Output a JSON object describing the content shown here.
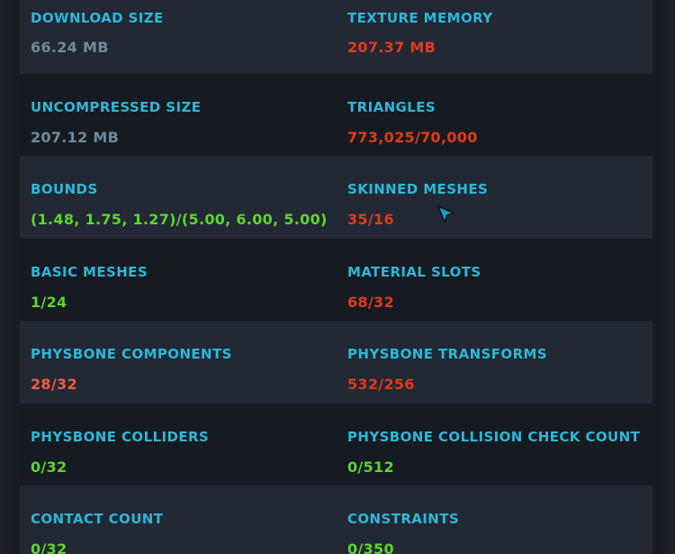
{
  "stats": [
    {
      "left": {
        "label": "DOWNLOAD SIZE",
        "value": "66.24 MB",
        "status": "neutral"
      },
      "right": {
        "label": "TEXTURE MEMORY",
        "value": "207.37 MB",
        "status": "bad"
      }
    },
    {
      "left": {
        "label": "UNCOMPRESSED SIZE",
        "value": "207.12 MB",
        "status": "neutral"
      },
      "right": {
        "label": "TRIANGLES",
        "value": "773,025/70,000",
        "status": "bad"
      }
    },
    {
      "left": {
        "label": "BOUNDS",
        "value": "(1.48, 1.75, 1.27)/(5.00, 6.00, 5.00)",
        "status": "good"
      },
      "right": {
        "label": "SKINNED MESHES",
        "value": "35/16",
        "status": "bad"
      }
    },
    {
      "left": {
        "label": "BASIC MESHES",
        "value": "1/24",
        "status": "good"
      },
      "right": {
        "label": "MATERIAL SLOTS",
        "value": "68/32",
        "status": "bad"
      }
    },
    {
      "left": {
        "label": "PHYSBONE COMPONENTS",
        "value": "28/32",
        "status": "warn"
      },
      "right": {
        "label": "PHYSBONE TRANSFORMS",
        "value": "532/256",
        "status": "bad"
      }
    },
    {
      "left": {
        "label": "PHYSBONE COLLIDERS",
        "value": "0/32",
        "status": "good"
      },
      "right": {
        "label": "PHYSBONE COLLISION CHECK COUNT",
        "value": "0/512",
        "status": "good"
      }
    },
    {
      "left": {
        "label": "CONTACT COUNT",
        "value": "0/32",
        "status": "good"
      },
      "right": {
        "label": "CONSTRAINTS",
        "value": "0/350",
        "status": "good"
      }
    }
  ],
  "colors": {
    "label": "#2eb7d7",
    "neutral": "#6e8c99",
    "bad": "#e03b1c",
    "warn": "#ef5a42",
    "good": "#5ed52c",
    "row_shaded": "#222834",
    "row_plain": "#161b22"
  },
  "cursor_icon": "pointer-arrow-icon"
}
